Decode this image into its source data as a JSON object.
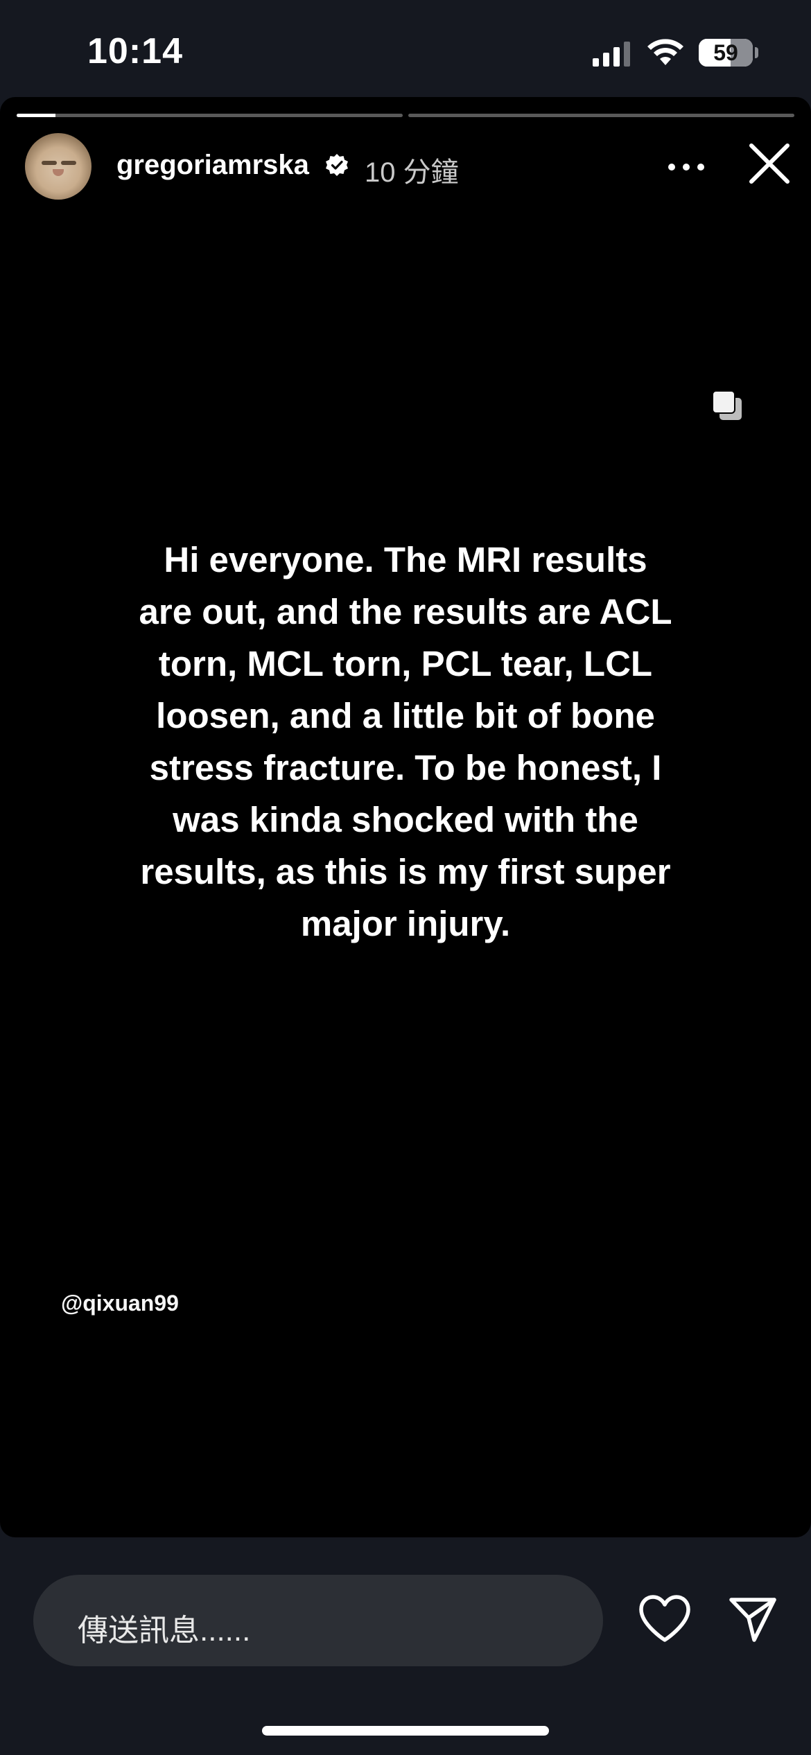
{
  "status_bar": {
    "time": "10:14",
    "battery_level": "59",
    "battery_fraction": 0.59
  },
  "story": {
    "progress": {
      "segments": 2,
      "current_segment": 1,
      "current_fraction": 0.1
    },
    "user": {
      "username": "gregoriamrska",
      "verified": true,
      "time_ago": "10 分鐘"
    },
    "text": "Hi everyone. The MRI results are out, and the results are ACL torn, MCL torn, PCL tear, LCL loosen, and a little bit of bone stress fracture. To be honest, I was kinda shocked with the results, as this is my first super major injury.",
    "mention": "@qixuan99"
  },
  "reply_bar": {
    "placeholder": "傳送訊息......"
  },
  "icons": {
    "verified": "verified-badge-icon",
    "more": "more-options-icon",
    "close": "close-icon",
    "gallery": "gallery-icon",
    "heart": "heart-icon",
    "send": "send-icon"
  },
  "colors": {
    "background": "#151820",
    "story_background": "#000000",
    "input_background": "#2c2f35"
  }
}
